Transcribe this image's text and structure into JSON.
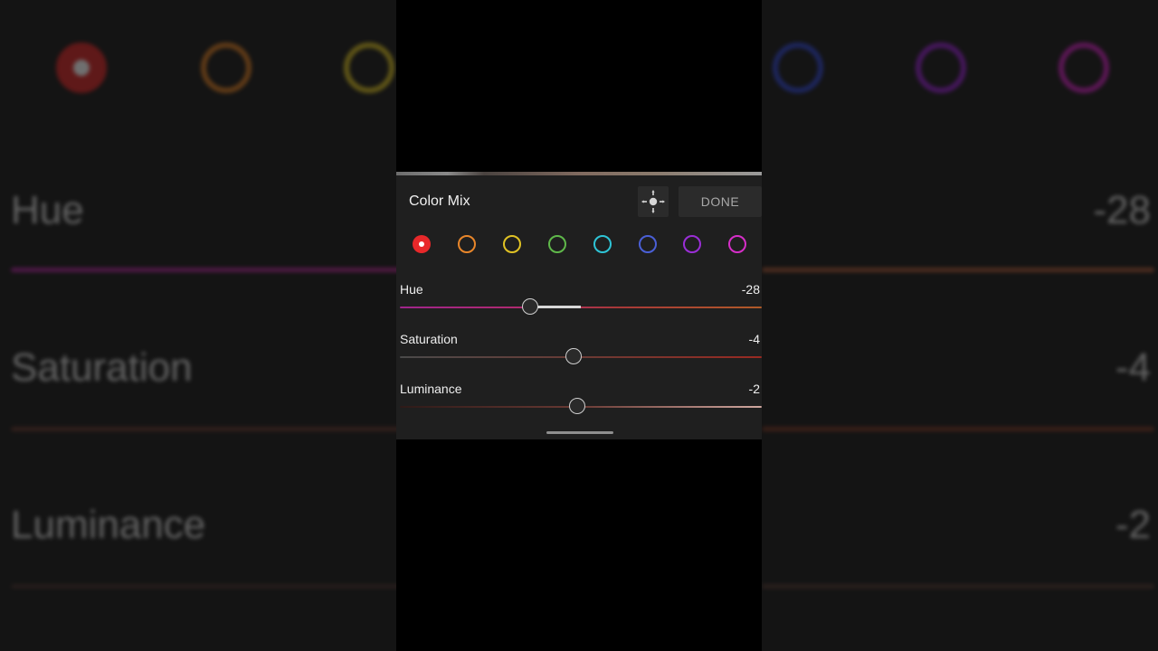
{
  "panel": {
    "title": "Color Mix",
    "done_label": "DONE",
    "target_icon": "targeted-adjustment-icon"
  },
  "swatches": [
    {
      "name": "red",
      "color": "#e8282a",
      "selected": true
    },
    {
      "name": "orange",
      "color": "#e8862a",
      "selected": false
    },
    {
      "name": "yellow",
      "color": "#e0c224",
      "selected": false
    },
    {
      "name": "green",
      "color": "#5fb84a",
      "selected": false
    },
    {
      "name": "aqua",
      "color": "#2ec4d6",
      "selected": false
    },
    {
      "name": "blue",
      "color": "#4a5fd6",
      "selected": false
    },
    {
      "name": "purple",
      "color": "#9a2ed6",
      "selected": false
    },
    {
      "name": "magenta",
      "color": "#d62ec8",
      "selected": false
    }
  ],
  "sliders": [
    {
      "label": "Hue",
      "value_text": "-28",
      "value": -28,
      "min": -100,
      "max": 100
    },
    {
      "label": "Saturation",
      "value_text": "-4",
      "value": -4,
      "min": -100,
      "max": 100
    },
    {
      "label": "Luminance",
      "value_text": "-2",
      "value": -2,
      "min": -100,
      "max": 100
    }
  ],
  "background": {
    "labels": [
      "Hue",
      "Saturation",
      "Luminance"
    ],
    "values": [
      "-28",
      "-4",
      "-2"
    ]
  }
}
